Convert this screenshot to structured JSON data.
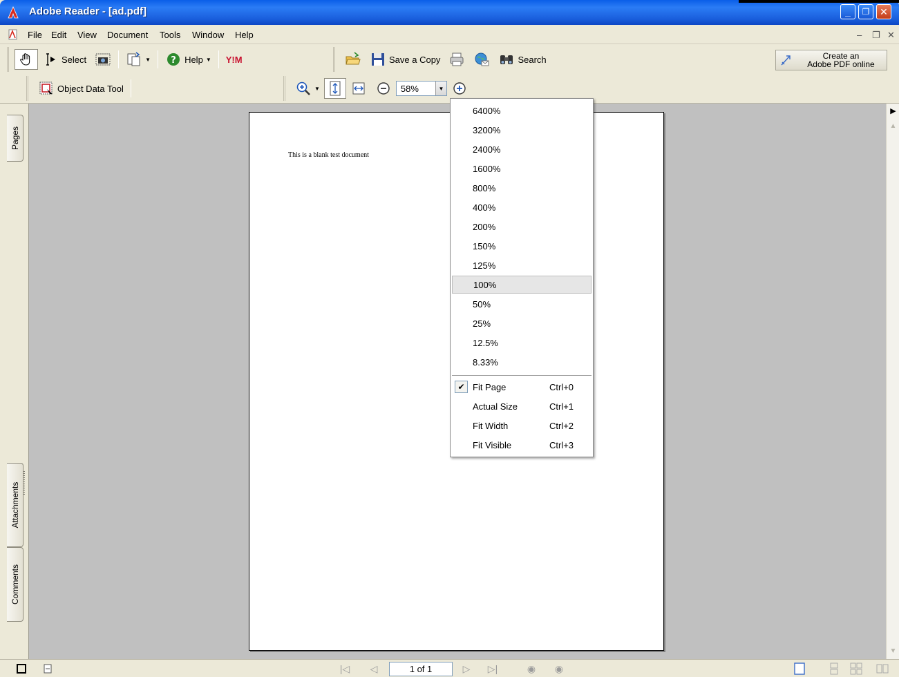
{
  "window": {
    "title": "Adobe Reader - [ad.pdf]",
    "min_glyph": "_",
    "restore_glyph": "❐",
    "close_glyph": "✕"
  },
  "menu": {
    "items": [
      "File",
      "Edit",
      "View",
      "Document",
      "Tools",
      "Window",
      "Help"
    ],
    "mdi_min": "–",
    "mdi_restore": "❐",
    "mdi_close": "✕"
  },
  "toolbar": {
    "select_label": "Select",
    "help_label": "Help",
    "save_copy_label": "Save a Copy",
    "search_label": "Search",
    "object_tool_label": "Object Data Tool",
    "zoom_value": "58%",
    "create_pdf_line1": "Create an",
    "create_pdf_line2": "Adobe PDF online",
    "yahoo_label": "Y!M"
  },
  "nav_tabs": {
    "pages": "Pages",
    "attachments": "Attachments",
    "comments": "Comments"
  },
  "document": {
    "text": "This is a blank test document"
  },
  "status": {
    "page_indicator": "1 of 1"
  },
  "zoom_menu": {
    "levels": [
      "6400%",
      "3200%",
      "2400%",
      "1600%",
      "800%",
      "400%",
      "200%",
      "150%",
      "125%",
      "100%",
      "50%",
      "25%",
      "12.5%",
      "8.33%"
    ],
    "highlighted": "100%",
    "options": [
      {
        "label": "Fit Page",
        "shortcut": "Ctrl+0",
        "checked": true
      },
      {
        "label": "Actual Size",
        "shortcut": "Ctrl+1",
        "checked": false
      },
      {
        "label": "Fit Width",
        "shortcut": "Ctrl+2",
        "checked": false
      },
      {
        "label": "Fit Visible",
        "shortcut": "Ctrl+3",
        "checked": false
      }
    ],
    "check_glyph": "✔"
  },
  "colors": {
    "titlebar": "#1a5fdd",
    "page_bg": "#c0c0c0",
    "chrome": "#ece9d8"
  }
}
